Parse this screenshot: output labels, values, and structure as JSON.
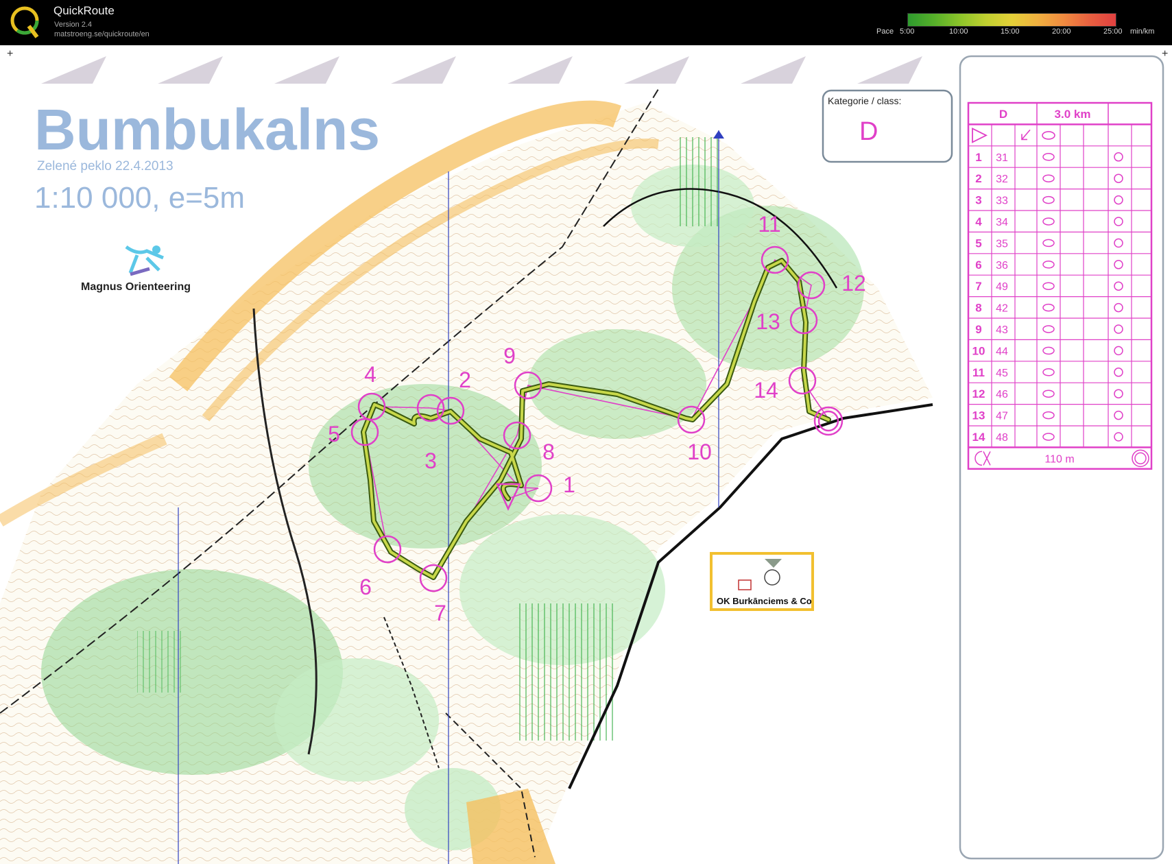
{
  "app": {
    "name": "QuickRoute",
    "version": "Version 2.4",
    "url": "matstroeng.se/quickroute/en",
    "logo_letter": "Q"
  },
  "pace_scale": {
    "label": "Pace",
    "ticks": [
      "5:00",
      "10:00",
      "15:00",
      "20:00",
      "25:00"
    ],
    "unit": "min/km"
  },
  "map": {
    "title": "Bumbukalns",
    "subtitle": "Zelené peklo 22.4.2013",
    "scale": "1:10 000, e=5m",
    "club_logo_text": "Magnus Orienteering",
    "category_label": "Kategorie / class:",
    "category_value": "D",
    "badge_text": "OK Burkānciems & Co",
    "controls": [
      {
        "number": "1"
      },
      {
        "number": "2"
      },
      {
        "number": "3"
      },
      {
        "number": "4"
      },
      {
        "number": "5"
      },
      {
        "number": "6"
      },
      {
        "number": "7"
      },
      {
        "number": "8"
      },
      {
        "number": "9"
      },
      {
        "number": "10"
      },
      {
        "number": "11"
      },
      {
        "number": "12"
      },
      {
        "number": "13"
      },
      {
        "number": "14"
      }
    ]
  },
  "control_description": {
    "class": "D",
    "length": "3.0 km",
    "finish_distance": "110 m",
    "rows": [
      {
        "num": "1",
        "code": "31"
      },
      {
        "num": "2",
        "code": "32"
      },
      {
        "num": "3",
        "code": "33"
      },
      {
        "num": "4",
        "code": "34"
      },
      {
        "num": "5",
        "code": "35"
      },
      {
        "num": "6",
        "code": "36"
      },
      {
        "num": "7",
        "code": "49"
      },
      {
        "num": "8",
        "code": "42"
      },
      {
        "num": "9",
        "code": "43"
      },
      {
        "num": "10",
        "code": "44"
      },
      {
        "num": "11",
        "code": "45"
      },
      {
        "num": "12",
        "code": "46"
      },
      {
        "num": "13",
        "code": "47"
      },
      {
        "num": "14",
        "code": "48"
      }
    ]
  },
  "colors": {
    "course": "#e040c8",
    "title": "#9bb8dc",
    "route": "#a8c030",
    "vegetation": "#8fd68f",
    "open": "#f5c060"
  }
}
